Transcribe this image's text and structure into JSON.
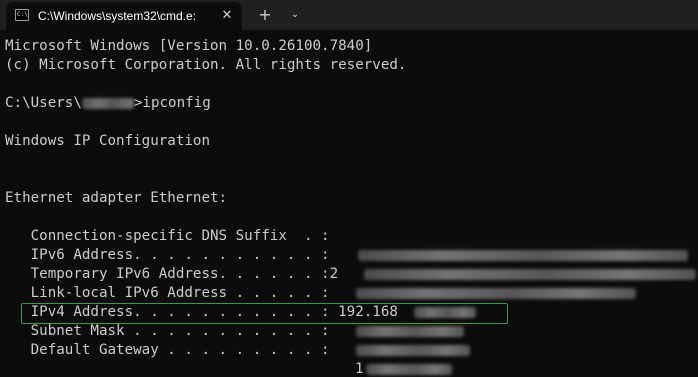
{
  "tab": {
    "icon_glyph": "C:\\",
    "title": "C:\\Windows\\system32\\cmd.e:",
    "close_glyph": "✕",
    "new_tab_glyph": "+",
    "dropdown_glyph": "⌄"
  },
  "console": {
    "banner_line1": "Microsoft Windows [Version 10.0.26100.7840]",
    "banner_line2": "(c) Microsoft Corporation. All rights reserved.",
    "prompt_prefix": "C:\\Users\\",
    "prompt_suffix": ">ipconfig",
    "ip_config_header": "Windows IP Configuration",
    "adapter_header": "Ethernet adapter Ethernet:",
    "rows": [
      {
        "label": "   Connection-specific DNS Suffix  . :",
        "value": ""
      },
      {
        "label": "   IPv6 Address. . . . . . . . . . . :",
        "value": ""
      },
      {
        "label": "   Temporary IPv6 Address. . . . . . :",
        "value": "2"
      },
      {
        "label": "   Link-local IPv6 Address . . . . . :",
        "value": ""
      },
      {
        "label": "   IPv4 Address. . . . . . . . . . . :",
        "value": " 192.168"
      },
      {
        "label": "   Subnet Mask . . . . . . . . . . . :",
        "value": ""
      },
      {
        "label": "   Default Gateway . . . . . . . . . :",
        "value": ""
      }
    ],
    "gateway_second_line": "1"
  },
  "colors": {
    "background": "#0c0c0c",
    "text": "#cccccc",
    "titlebar": "#202020",
    "highlight": "#3c9a3c"
  }
}
